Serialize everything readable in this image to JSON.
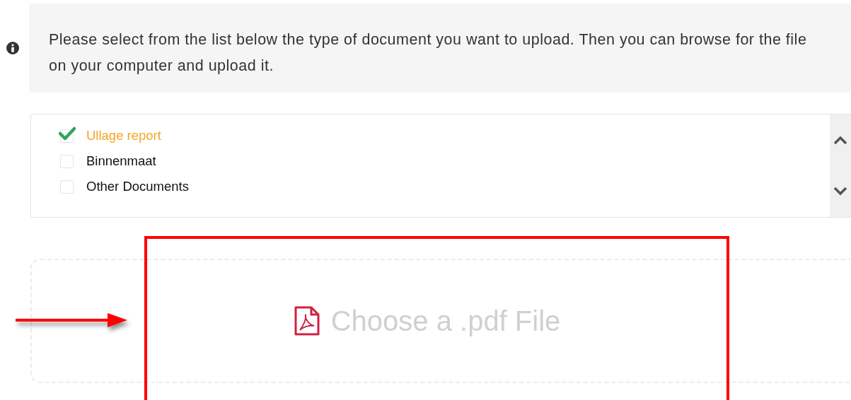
{
  "info": {
    "text": "Please select from the list below the type of document you want to upload. Then you can browse for the file on your computer and upload it."
  },
  "document_types": [
    {
      "label": "Ullage report",
      "checked": true
    },
    {
      "label": "Binnenmaat",
      "checked": false
    },
    {
      "label": "Other Documents",
      "checked": false
    }
  ],
  "dropzone": {
    "label": "Choose a .pdf File"
  },
  "annotation": {
    "highlight": true,
    "arrow": true
  }
}
